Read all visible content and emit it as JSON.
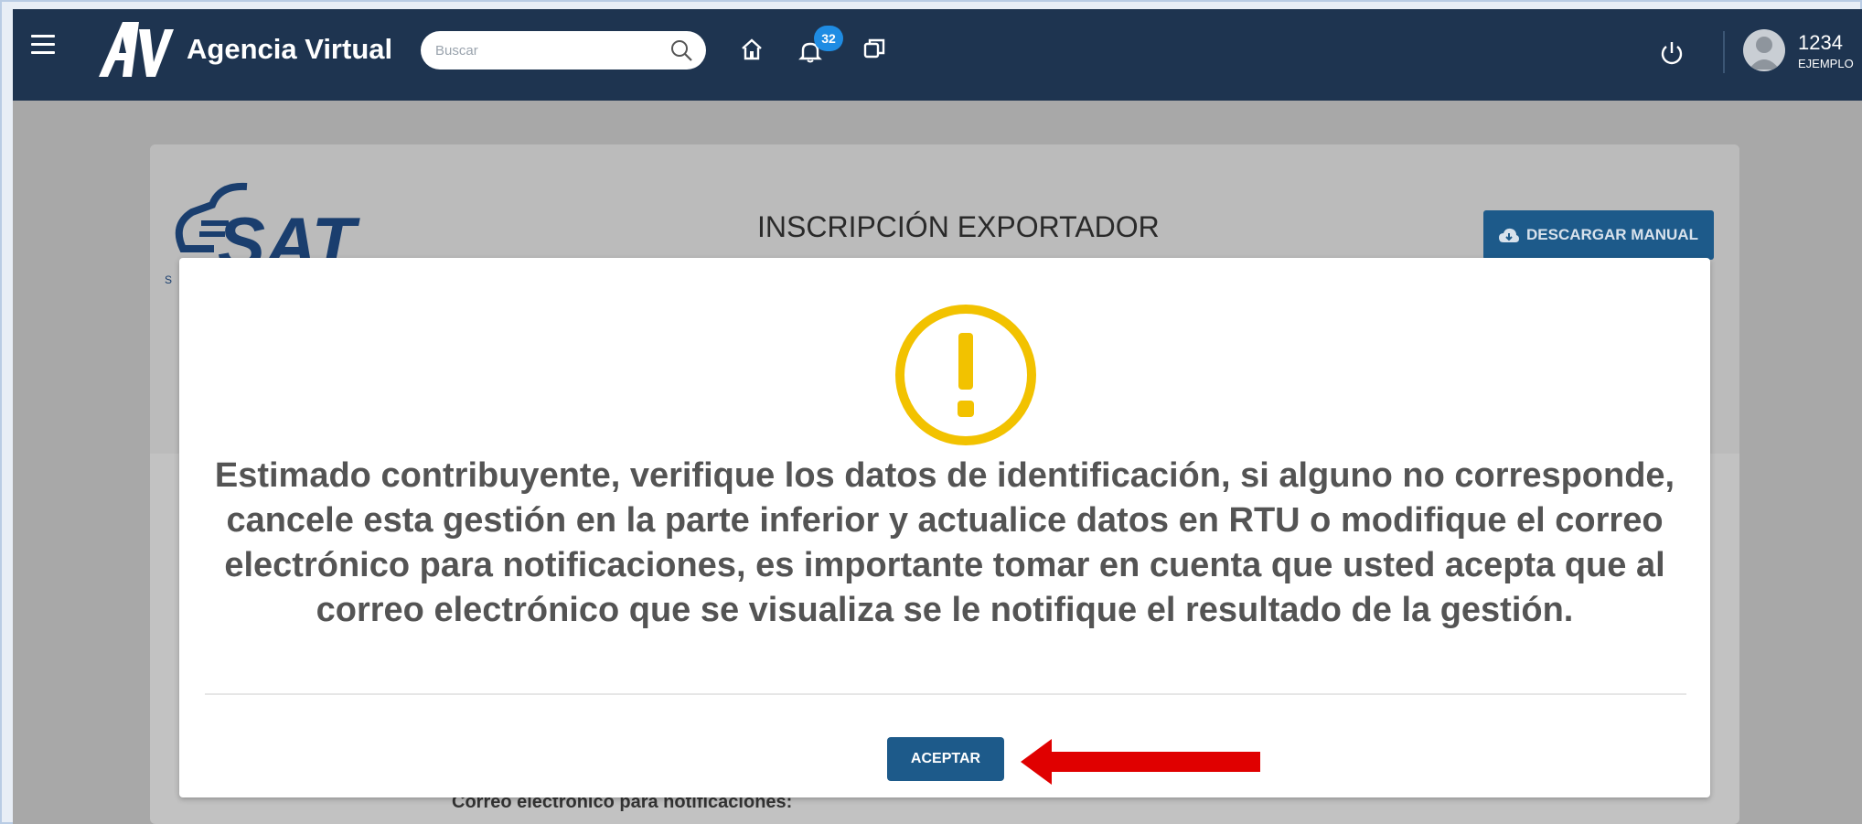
{
  "header": {
    "app_title": "Agencia Virtual",
    "search_placeholder": "Buscar",
    "notification_count": "32",
    "user_id": "1234",
    "user_name": "EJEMPLO",
    "bg_color": "#1e3450"
  },
  "page": {
    "title": "INSCRIPCIÓN EXPORTADOR",
    "download_manual_label": "DESCARGAR MANUAL",
    "logo_text": "SAT",
    "behind_label": "Correo electrónico para notificaciones:"
  },
  "modal": {
    "icon": "warning-icon",
    "icon_color": "#f2c200",
    "message": "Estimado contribuyente, verifique los datos de identificación, si alguno no corresponde, cancele esta gestión en la parte inferior y actualice datos en RTU o modifique el correo electrónico para notificaciones, es importante tomar en cuenta que usted acepta que al correo electrónico que se visualiza se le notifique el resultado de la gestión.",
    "accept_label": "ACEPTAR",
    "accent_color": "#1d5a8a",
    "annotation_arrow_color": "#e00000"
  }
}
